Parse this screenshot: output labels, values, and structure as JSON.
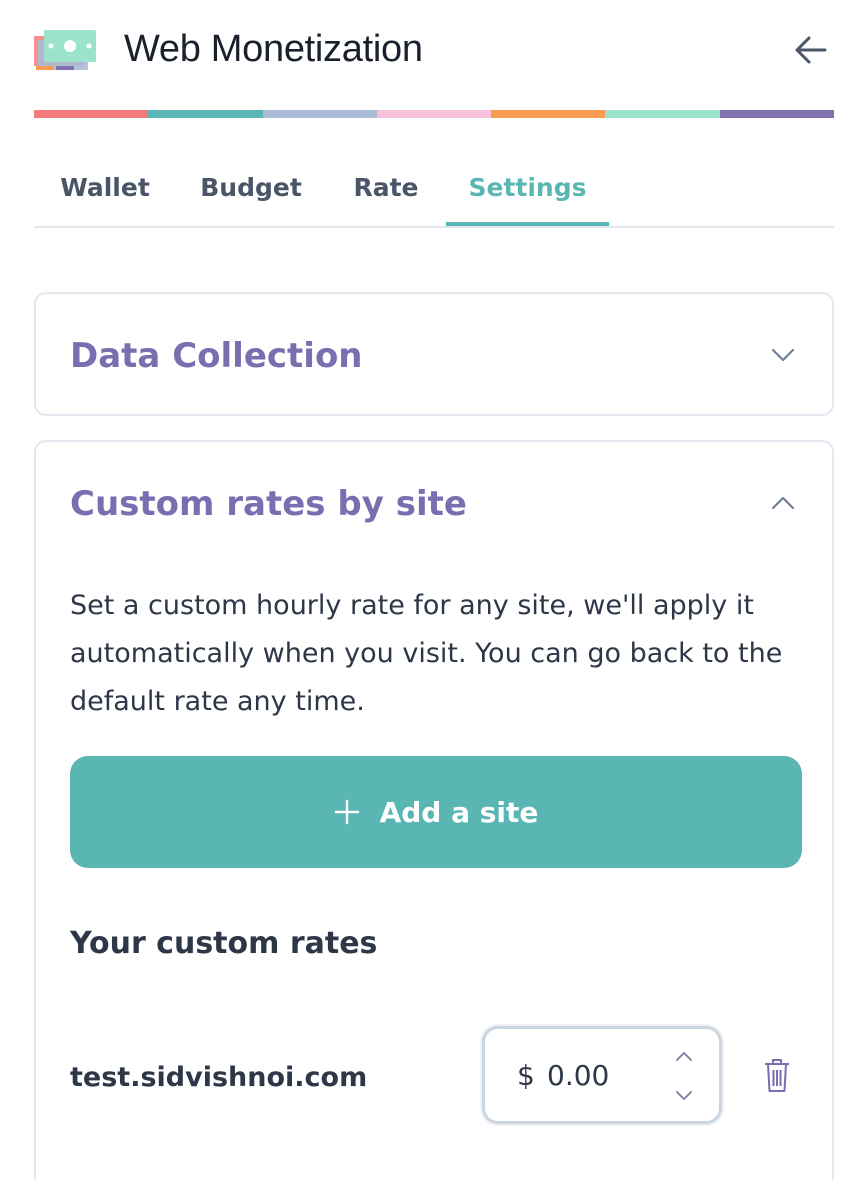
{
  "app": {
    "title": "Web Monetization",
    "logo_icon": "money-icon",
    "back_icon": "arrow-left-icon"
  },
  "brand_stripe": [
    "#f47c7c",
    "#5ab6b2",
    "#a9bdd6",
    "#f9c0d9",
    "#f99a51",
    "#9ce3cc",
    "#7e71ae"
  ],
  "tabs": [
    {
      "label": "Wallet"
    },
    {
      "label": "Budget"
    },
    {
      "label": "Rate"
    },
    {
      "label": "Settings",
      "active": true
    }
  ],
  "data_collection": {
    "title": "Data Collection",
    "expanded": false
  },
  "custom_rates": {
    "title": "Custom rates by site",
    "expanded": true,
    "description": "Set a custom hourly rate for any site, we'll apply it automatically when you visit. You can go back to the default rate any time.",
    "add_button_label": "Add a site",
    "list_title": "Your custom rates",
    "rates": [
      {
        "site": "test.sidvishnoi.com",
        "currency": "$",
        "value": "0.00"
      }
    ]
  },
  "colors": {
    "accent": "#5ab6b2",
    "heading_purple": "#7b6eb0",
    "text": "#2d3748"
  }
}
